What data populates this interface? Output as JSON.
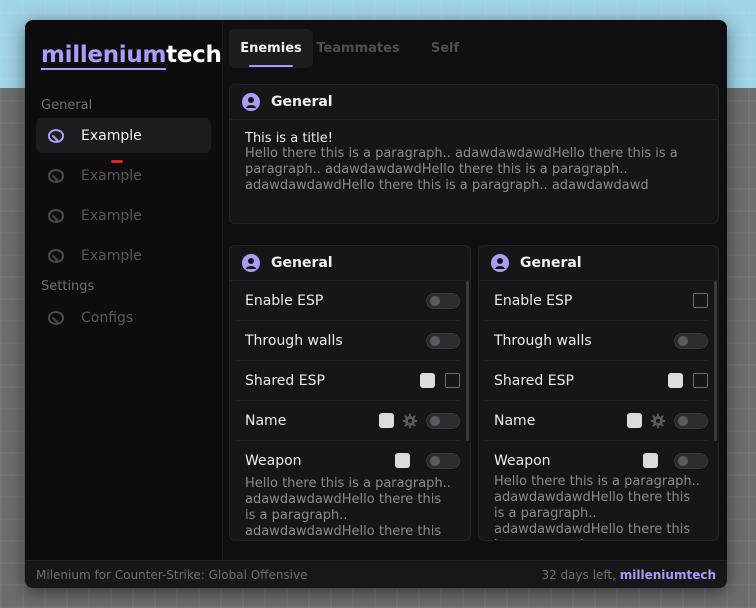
{
  "brand": {
    "part1": "millenium",
    "part2": "tech"
  },
  "sidebar": {
    "sections": [
      {
        "label": "General",
        "items": [
          "Example",
          "Example",
          "Example",
          "Example"
        ]
      },
      {
        "label": "Settings",
        "items": [
          "Configs"
        ]
      }
    ]
  },
  "tabs": [
    "Enemies",
    "Teammates",
    "Self"
  ],
  "top_panel": {
    "title": "General",
    "content_title": "This is a title!",
    "paragraph": "Hello there this is a paragraph.. adawdawdawdHello there this is a paragraph.. adawdawdawdHello there this is a paragraph.. adawdawdawdHello there this is a paragraph.. adawdawdawd"
  },
  "left_panel": {
    "title": "General",
    "rows": [
      "Enable ESP",
      "Through walls",
      "Shared ESP",
      "Name",
      "Weapon"
    ],
    "paragraph": "Hello there this is a paragraph.. adawdawdawdHello there this is a paragraph.. adawdawdawdHello there this is a paragraph.."
  },
  "right_panel": {
    "title": "General",
    "rows": [
      "Enable ESP",
      "Through walls",
      "Shared ESP",
      "Name",
      "Weapon"
    ],
    "paragraph": "Hello there this is a paragraph.. adawdawdawdHello there this is a paragraph.. adawdawdawdHello there this is a paragraph.."
  },
  "footer": {
    "left": "Milenium for Counter-Strike: Global Offensive",
    "right_prefix": "32 days left,",
    "right_brand": "milleniumtech"
  },
  "colors": {
    "accent": "#a99df5",
    "background": "#0f0f11",
    "panel": "#161619",
    "marker": "#e0202a"
  },
  "icons": {
    "nav": "link-icon",
    "panel": "user-icon",
    "settings": "gear-icon"
  }
}
